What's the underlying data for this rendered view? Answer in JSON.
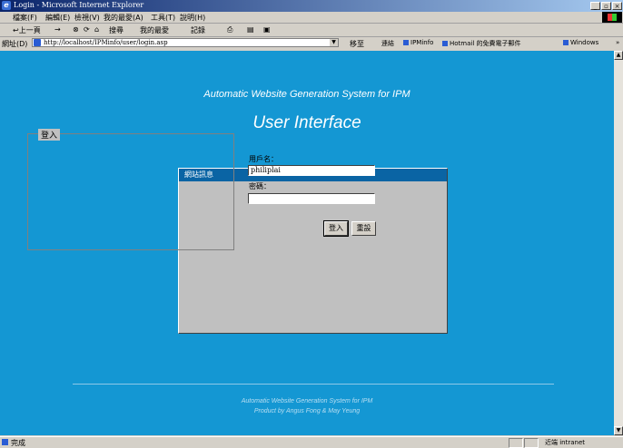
{
  "window": {
    "title": "Login - Microsoft Internet Explorer",
    "icon": "ie-icon",
    "buttons": [
      "_",
      "▫",
      "×"
    ]
  },
  "menu": [
    "檔案(F)",
    "編輯(E)",
    "檢視(V)",
    "我的最愛(A)",
    "工具(T)",
    "說明(H)"
  ],
  "toolbar": {
    "back": "↩上一頁",
    "forward": "→",
    "stop": "⊗",
    "refresh": "⟳",
    "home": "⌂",
    "search": "搜尋",
    "favorites": "我的最愛",
    "history": "記錄",
    "mail": "⎙",
    "print": "▤",
    "edit": "▣"
  },
  "address": {
    "label": "網址(D)",
    "url": "http://localhost/IPMinfo/user/login.asp",
    "go": "移至",
    "links_label": "連結",
    "links": [
      "IPMinfo",
      "Hotmail 的免費電子郵件",
      "Windows"
    ],
    "more": "»"
  },
  "page": {
    "subtitle": "Automatic Website Generation System for IPM",
    "title": "User Interface",
    "background": "#1497d3",
    "panel": {
      "header": "網站訊息",
      "legend": "登入",
      "username_label": "用戶名：",
      "username_value": "philiplai",
      "password_label": "密碼：",
      "password_value": "",
      "login_button": "登入",
      "reset_button": "重設"
    },
    "footer": {
      "line1": "Automatic Website Generation System for IPM",
      "line2": "Product by Angus Fong & May Yeung"
    }
  },
  "status": {
    "text": "完成",
    "zone": "近端 intranet"
  }
}
